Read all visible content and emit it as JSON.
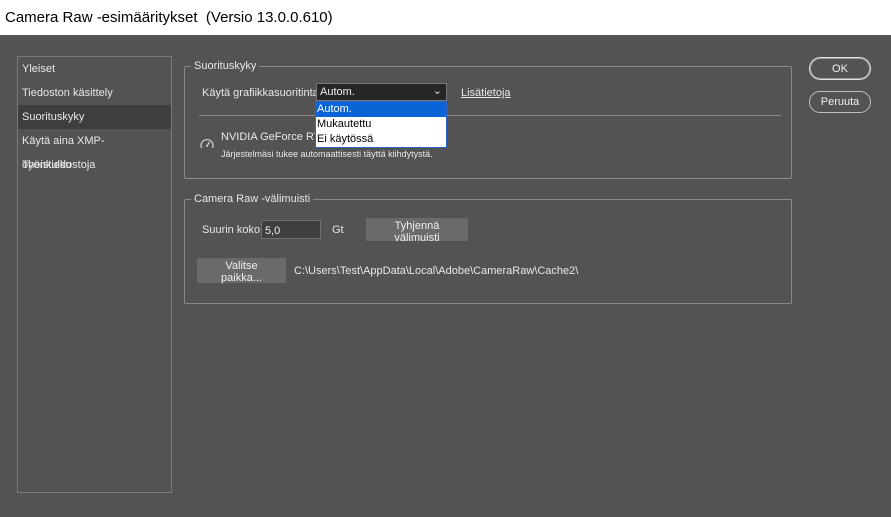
{
  "window": {
    "title": "Camera Raw -esimääritykset",
    "version": "(Versio 13.0.0.610)"
  },
  "sidebar": {
    "items": [
      {
        "label": "Yleiset"
      },
      {
        "label": "Tiedoston käsittely"
      },
      {
        "label": "Suorituskyky",
        "selected": true
      },
      {
        "label": "Käytä aina XMP-oheistiedostoja"
      },
      {
        "label": "Työnkulku"
      }
    ]
  },
  "performance": {
    "group_title": "Suorituskyky",
    "gpu_label": "Käytä grafiikkasuoritinta:",
    "gpu_value": "Autom.",
    "more_info": "Lisätietoja",
    "options": [
      "Autom.",
      "Mukautettu",
      "Ei käytössä"
    ],
    "gpu_name": "NVIDIA GeForce RTX",
    "gpu_status": "Järjestelmäsi tukee automaattisesti täyttä kiihdytystä."
  },
  "cache": {
    "group_title": "Camera Raw -välimuisti",
    "size_label": "Suurin koko:",
    "size_value": "5,0",
    "unit": "Gt",
    "purge_button": "Tyhjennä välimuisti",
    "choose_button": "Valitse paikka...",
    "path": "C:\\Users\\Test\\AppData\\Local\\Adobe\\CameraRaw\\Cache2\\"
  },
  "buttons": {
    "ok": "OK",
    "cancel": "Peruuta"
  },
  "icons": {
    "gpu": "speedometer-icon",
    "dropdown": "chevron-down-icon"
  }
}
